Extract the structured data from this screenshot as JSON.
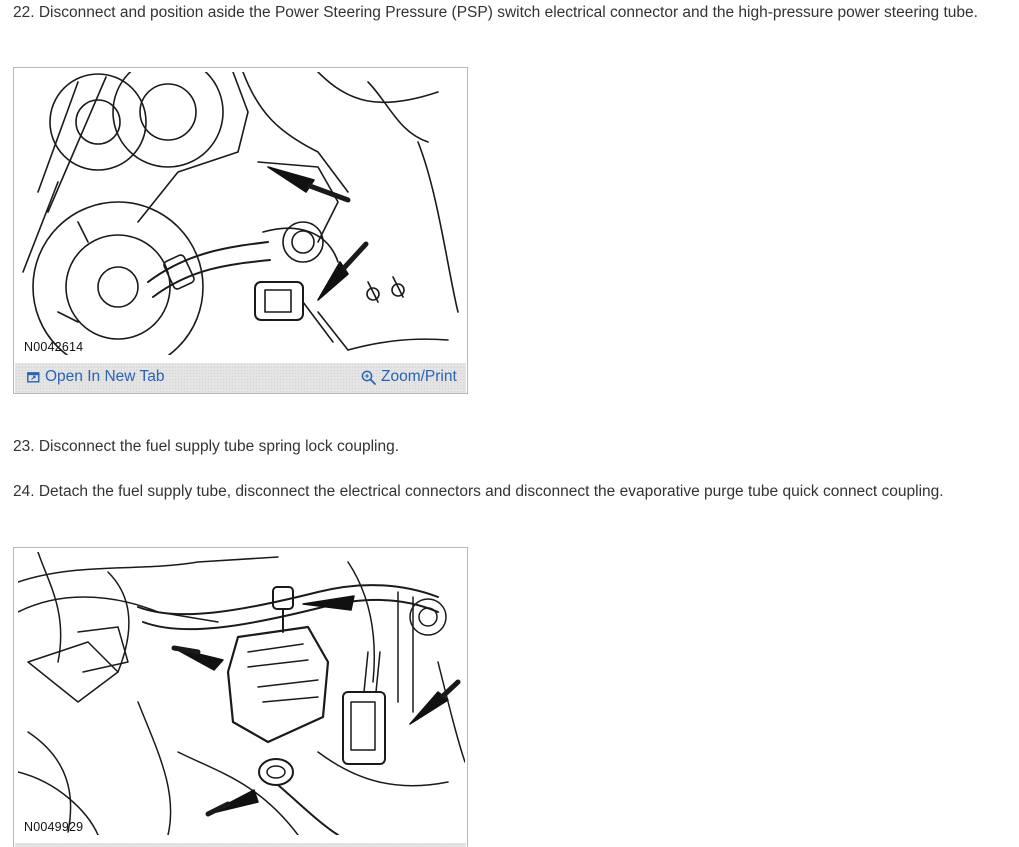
{
  "steps": [
    {
      "text": "22. Disconnect and position aside the Power Steering Pressure (PSP) switch electrical connector and the high-pressure power steering tube."
    },
    {
      "text": "23. Disconnect the fuel supply tube spring lock coupling."
    },
    {
      "text": "24. Detach the fuel supply tube, disconnect the electrical connectors and disconnect the evaporative purge tube quick connect coupling."
    }
  ],
  "figures": [
    {
      "code": "N0042614",
      "open_tab_label": "Open In New Tab",
      "zoom_label": "Zoom/Print"
    },
    {
      "code": "N0049929"
    }
  ],
  "colors": {
    "text": "#333333",
    "link": "#2a63b4",
    "bar_background": "#e4e4e4",
    "figure_border": "#b8b8b8"
  },
  "icons": {
    "open_tab": "open-new-tab-icon",
    "zoom": "magnifier-icon"
  }
}
